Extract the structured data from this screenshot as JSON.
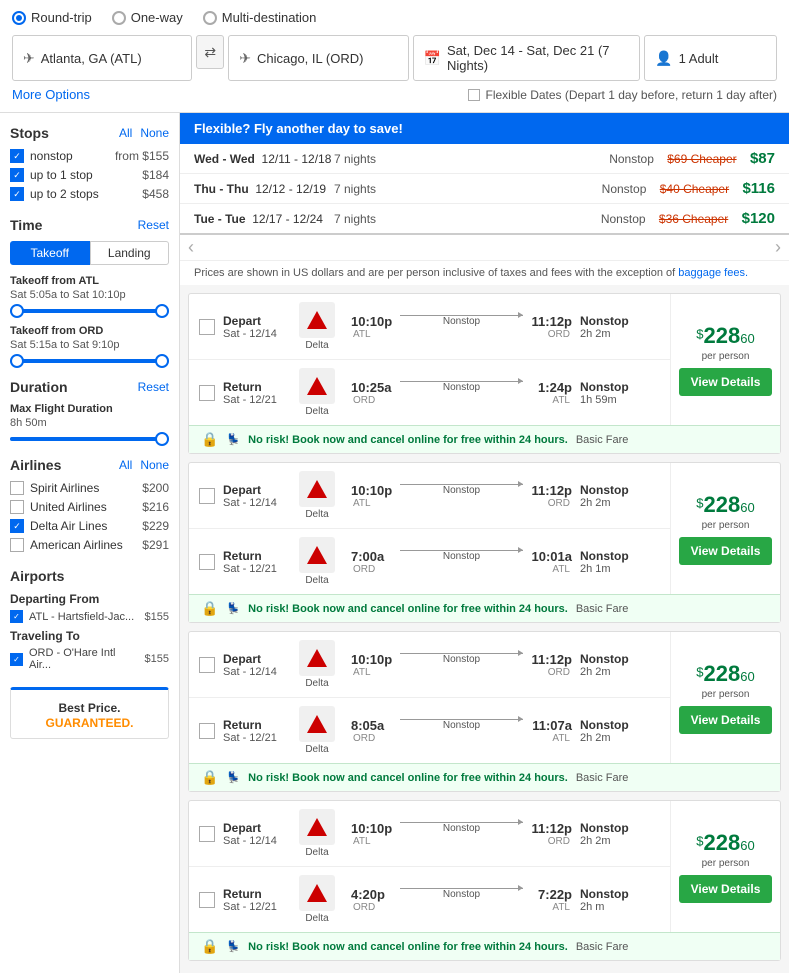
{
  "trip_types": [
    {
      "id": "roundtrip",
      "label": "Round-trip",
      "selected": true
    },
    {
      "id": "oneway",
      "label": "One-way",
      "selected": false
    },
    {
      "id": "multidest",
      "label": "Multi-destination",
      "selected": false
    }
  ],
  "search": {
    "origin": "Atlanta, GA (ATL)",
    "destination": "Chicago, IL (ORD)",
    "dates": "Sat, Dec 14 - Sat, Dec 21 (7 Nights)",
    "passengers": "1 Adult",
    "more_options": "More Options",
    "flexible_dates_label": "Flexible Dates (Depart 1 day before, return 1 day after)"
  },
  "sidebar": {
    "stops_title": "Stops",
    "stops_all": "All",
    "stops_none": "None",
    "stops": [
      {
        "label": "nonstop",
        "price": "from $155",
        "checked": true
      },
      {
        "label": "up to 1 stop",
        "price": "$184",
        "checked": true
      },
      {
        "label": "up to 2 stops",
        "price": "$458",
        "checked": true
      }
    ],
    "time_title": "Time",
    "time_reset": "Reset",
    "time_takeoff": "Takeoff",
    "time_landing": "Landing",
    "takeoff_from_atl": "Takeoff from ATL",
    "takeoff_from_atl_range": "Sat 5:05a to Sat 10:10p",
    "takeoff_from_ord": "Takeoff from ORD",
    "takeoff_from_ord_range": "Sat 5:15a to Sat 9:10p",
    "duration_title": "Duration",
    "duration_reset": "Reset",
    "max_flight_label": "Max Flight Duration",
    "max_flight_value": "8h 50m",
    "airlines_title": "Airlines",
    "airlines_all": "All",
    "airlines_none": "None",
    "airlines": [
      {
        "label": "Spirit Airlines",
        "price": "$200",
        "checked": false
      },
      {
        "label": "United Airlines",
        "price": "$216",
        "checked": false
      },
      {
        "label": "Delta Air Lines",
        "price": "$229",
        "checked": true
      },
      {
        "label": "American Airlines",
        "price": "$291",
        "checked": false
      }
    ],
    "airports_title": "Airports",
    "departing_from": "Departing From",
    "airports_departing": [
      {
        "code": "ATL - Hartsfield-Jac...",
        "price": "$155",
        "checked": true
      }
    ],
    "traveling_to": "Traveling To",
    "airports_arriving": [
      {
        "code": "ORD - O'Hare Intl Air...",
        "price": "$155",
        "checked": true
      }
    ],
    "best_price_label": "Best Price.",
    "best_price_guaranteed": "GUARANTEED."
  },
  "flex_banner": {
    "title": "Flexible? Fly another day to save!",
    "rows": [
      {
        "days": "Wed - Wed",
        "dates": "12/11 - 12/18",
        "nights": "7 nights",
        "stop": "Nonstop",
        "cheaper_text": "$69 Cheaper",
        "price": "$87"
      },
      {
        "days": "Thu - Thu",
        "dates": "12/12 - 12/19",
        "nights": "7 nights",
        "stop": "Nonstop",
        "cheaper_text": "$40 Cheaper",
        "price": "$116"
      },
      {
        "days": "Tue - Tue",
        "dates": "12/17 - 12/24",
        "nights": "7 nights",
        "stop": "Nonstop",
        "cheaper_text": "$36 Cheaper",
        "price": "$120"
      }
    ]
  },
  "disclaimer": "Prices are shown in US dollars and are per person inclusive of taxes and fees with the exception of",
  "disclaimer_link": "baggage fees.",
  "flights": [
    {
      "price_dollars": "$228",
      "price_cents": "60",
      "per_person": "per person",
      "view_details": "View Details",
      "segments": [
        {
          "type": "Depart",
          "date": "Sat - 12/14",
          "airline": "Delta",
          "depart_time": "10:10p",
          "depart_airport": "ATL",
          "arrive_time": "11:12p",
          "arrive_airport": "ORD",
          "stop": "Nonstop",
          "duration": "2h 2m"
        },
        {
          "type": "Return",
          "date": "Sat - 12/21",
          "airline": "Delta",
          "depart_time": "10:25a",
          "depart_airport": "ORD",
          "arrive_time": "1:24p",
          "arrive_airport": "ATL",
          "stop": "Nonstop",
          "duration": "1h 59m"
        }
      ],
      "promo": "No risk! Book now and cancel online for free within 24 hours.",
      "fare": "Basic Fare"
    },
    {
      "price_dollars": "$228",
      "price_cents": "60",
      "per_person": "per person",
      "view_details": "View Details",
      "segments": [
        {
          "type": "Depart",
          "date": "Sat - 12/14",
          "airline": "Delta",
          "depart_time": "10:10p",
          "depart_airport": "ATL",
          "arrive_time": "11:12p",
          "arrive_airport": "ORD",
          "stop": "Nonstop",
          "duration": "2h 2m"
        },
        {
          "type": "Return",
          "date": "Sat - 12/21",
          "airline": "Delta",
          "depart_time": "7:00a",
          "depart_airport": "ORD",
          "arrive_time": "10:01a",
          "arrive_airport": "ATL",
          "stop": "Nonstop",
          "duration": "2h 1m"
        }
      ],
      "promo": "No risk! Book now and cancel online for free within 24 hours.",
      "fare": "Basic Fare"
    },
    {
      "price_dollars": "$228",
      "price_cents": "60",
      "per_person": "per person",
      "view_details": "View Details",
      "segments": [
        {
          "type": "Depart",
          "date": "Sat - 12/14",
          "airline": "Delta",
          "depart_time": "10:10p",
          "depart_airport": "ATL",
          "arrive_time": "11:12p",
          "arrive_airport": "ORD",
          "stop": "Nonstop",
          "duration": "2h 2m"
        },
        {
          "type": "Return",
          "date": "Sat - 12/21",
          "airline": "Delta",
          "depart_time": "8:05a",
          "depart_airport": "ORD",
          "arrive_time": "11:07a",
          "arrive_airport": "ATL",
          "stop": "Nonstop",
          "duration": "2h 2m"
        }
      ],
      "promo": "No risk! Book now and cancel online for free within 24 hours.",
      "fare": "Basic Fare"
    },
    {
      "price_dollars": "$228",
      "price_cents": "60",
      "per_person": "per person",
      "view_details": "View Details",
      "segments": [
        {
          "type": "Depart",
          "date": "Sat - 12/14",
          "airline": "Delta",
          "depart_time": "10:10p",
          "depart_airport": "ATL",
          "arrive_time": "11:12p",
          "arrive_airport": "ORD",
          "stop": "Nonstop",
          "duration": "2h 2m"
        },
        {
          "type": "Return",
          "date": "Sat - 12/21",
          "airline": "Delta",
          "depart_time": "4:20p",
          "depart_airport": "ORD",
          "arrive_time": "7:22p",
          "arrive_airport": "ATL",
          "stop": "Nonstop",
          "duration": "2h m"
        }
      ],
      "promo": "No risk! Book now and cancel online for free within 24 hours.",
      "fare": "Basic Fare"
    }
  ],
  "colors": {
    "blue": "#0068ef",
    "green": "#007a3d",
    "green_btn": "#28a745",
    "red_cheaper": "#cc3300",
    "promo_green": "#007a3d",
    "promo_bg": "#f0fff4"
  }
}
